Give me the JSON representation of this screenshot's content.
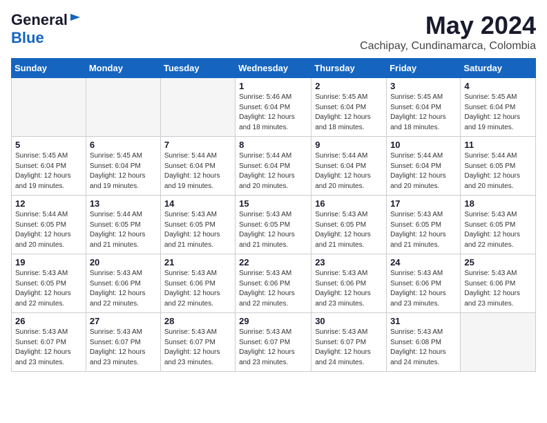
{
  "header": {
    "logo_general": "General",
    "logo_blue": "Blue",
    "month_title": "May 2024",
    "location": "Cachipay, Cundinamarca, Colombia"
  },
  "days_of_week": [
    "Sunday",
    "Monday",
    "Tuesday",
    "Wednesday",
    "Thursday",
    "Friday",
    "Saturday"
  ],
  "weeks": [
    [
      {
        "day": "",
        "info": ""
      },
      {
        "day": "",
        "info": ""
      },
      {
        "day": "",
        "info": ""
      },
      {
        "day": "1",
        "info": "Sunrise: 5:46 AM\nSunset: 6:04 PM\nDaylight: 12 hours\nand 18 minutes."
      },
      {
        "day": "2",
        "info": "Sunrise: 5:45 AM\nSunset: 6:04 PM\nDaylight: 12 hours\nand 18 minutes."
      },
      {
        "day": "3",
        "info": "Sunrise: 5:45 AM\nSunset: 6:04 PM\nDaylight: 12 hours\nand 18 minutes."
      },
      {
        "day": "4",
        "info": "Sunrise: 5:45 AM\nSunset: 6:04 PM\nDaylight: 12 hours\nand 19 minutes."
      }
    ],
    [
      {
        "day": "5",
        "info": "Sunrise: 5:45 AM\nSunset: 6:04 PM\nDaylight: 12 hours\nand 19 minutes."
      },
      {
        "day": "6",
        "info": "Sunrise: 5:45 AM\nSunset: 6:04 PM\nDaylight: 12 hours\nand 19 minutes."
      },
      {
        "day": "7",
        "info": "Sunrise: 5:44 AM\nSunset: 6:04 PM\nDaylight: 12 hours\nand 19 minutes."
      },
      {
        "day": "8",
        "info": "Sunrise: 5:44 AM\nSunset: 6:04 PM\nDaylight: 12 hours\nand 20 minutes."
      },
      {
        "day": "9",
        "info": "Sunrise: 5:44 AM\nSunset: 6:04 PM\nDaylight: 12 hours\nand 20 minutes."
      },
      {
        "day": "10",
        "info": "Sunrise: 5:44 AM\nSunset: 6:04 PM\nDaylight: 12 hours\nand 20 minutes."
      },
      {
        "day": "11",
        "info": "Sunrise: 5:44 AM\nSunset: 6:05 PM\nDaylight: 12 hours\nand 20 minutes."
      }
    ],
    [
      {
        "day": "12",
        "info": "Sunrise: 5:44 AM\nSunset: 6:05 PM\nDaylight: 12 hours\nand 20 minutes."
      },
      {
        "day": "13",
        "info": "Sunrise: 5:44 AM\nSunset: 6:05 PM\nDaylight: 12 hours\nand 21 minutes."
      },
      {
        "day": "14",
        "info": "Sunrise: 5:43 AM\nSunset: 6:05 PM\nDaylight: 12 hours\nand 21 minutes."
      },
      {
        "day": "15",
        "info": "Sunrise: 5:43 AM\nSunset: 6:05 PM\nDaylight: 12 hours\nand 21 minutes."
      },
      {
        "day": "16",
        "info": "Sunrise: 5:43 AM\nSunset: 6:05 PM\nDaylight: 12 hours\nand 21 minutes."
      },
      {
        "day": "17",
        "info": "Sunrise: 5:43 AM\nSunset: 6:05 PM\nDaylight: 12 hours\nand 21 minutes."
      },
      {
        "day": "18",
        "info": "Sunrise: 5:43 AM\nSunset: 6:05 PM\nDaylight: 12 hours\nand 22 minutes."
      }
    ],
    [
      {
        "day": "19",
        "info": "Sunrise: 5:43 AM\nSunset: 6:05 PM\nDaylight: 12 hours\nand 22 minutes."
      },
      {
        "day": "20",
        "info": "Sunrise: 5:43 AM\nSunset: 6:06 PM\nDaylight: 12 hours\nand 22 minutes."
      },
      {
        "day": "21",
        "info": "Sunrise: 5:43 AM\nSunset: 6:06 PM\nDaylight: 12 hours\nand 22 minutes."
      },
      {
        "day": "22",
        "info": "Sunrise: 5:43 AM\nSunset: 6:06 PM\nDaylight: 12 hours\nand 22 minutes."
      },
      {
        "day": "23",
        "info": "Sunrise: 5:43 AM\nSunset: 6:06 PM\nDaylight: 12 hours\nand 23 minutes."
      },
      {
        "day": "24",
        "info": "Sunrise: 5:43 AM\nSunset: 6:06 PM\nDaylight: 12 hours\nand 23 minutes."
      },
      {
        "day": "25",
        "info": "Sunrise: 5:43 AM\nSunset: 6:06 PM\nDaylight: 12 hours\nand 23 minutes."
      }
    ],
    [
      {
        "day": "26",
        "info": "Sunrise: 5:43 AM\nSunset: 6:07 PM\nDaylight: 12 hours\nand 23 minutes."
      },
      {
        "day": "27",
        "info": "Sunrise: 5:43 AM\nSunset: 6:07 PM\nDaylight: 12 hours\nand 23 minutes."
      },
      {
        "day": "28",
        "info": "Sunrise: 5:43 AM\nSunset: 6:07 PM\nDaylight: 12 hours\nand 23 minutes."
      },
      {
        "day": "29",
        "info": "Sunrise: 5:43 AM\nSunset: 6:07 PM\nDaylight: 12 hours\nand 23 minutes."
      },
      {
        "day": "30",
        "info": "Sunrise: 5:43 AM\nSunset: 6:07 PM\nDaylight: 12 hours\nand 24 minutes."
      },
      {
        "day": "31",
        "info": "Sunrise: 5:43 AM\nSunset: 6:08 PM\nDaylight: 12 hours\nand 24 minutes."
      },
      {
        "day": "",
        "info": ""
      }
    ]
  ]
}
